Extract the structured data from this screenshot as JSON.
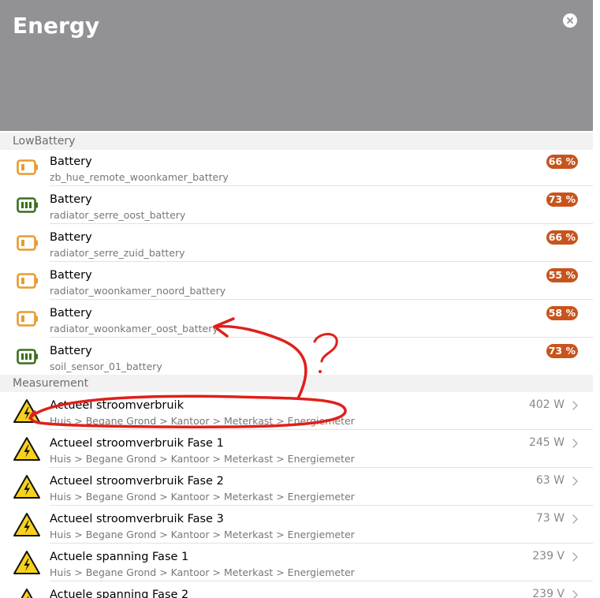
{
  "header": {
    "title": "Energy"
  },
  "sections": {
    "low_battery": "LowBattery",
    "measurement": "Measurement"
  },
  "battery_items": [
    {
      "title": "Battery",
      "subtitle": "zb_hue_remote_woonkamer_battery",
      "value": "66 %",
      "level": "low"
    },
    {
      "title": "Battery",
      "subtitle": "radiator_serre_oost_battery",
      "value": "73 %",
      "level": "high"
    },
    {
      "title": "Battery",
      "subtitle": "radiator_serre_zuid_battery",
      "value": "66 %",
      "level": "low"
    },
    {
      "title": "Battery",
      "subtitle": "radiator_woonkamer_noord_battery",
      "value": "55 %",
      "level": "low"
    },
    {
      "title": "Battery",
      "subtitle": "radiator_woonkamer_oost_battery",
      "value": "58 %",
      "level": "low"
    },
    {
      "title": "Battery",
      "subtitle": "soil_sensor_01_battery",
      "value": "73 %",
      "level": "high"
    }
  ],
  "measurement_items": [
    {
      "title": "Actueel stroomverbruik",
      "subtitle": "Huis > Begane Grond > Kantoor > Meterkast > Energiemeter",
      "value": "402 W"
    },
    {
      "title": "Actueel stroomverbruik Fase 1",
      "subtitle": "Huis > Begane Grond > Kantoor > Meterkast > Energiemeter",
      "value": "245 W"
    },
    {
      "title": "Actueel stroomverbruik Fase 2",
      "subtitle": "Huis > Begane Grond > Kantoor > Meterkast > Energiemeter",
      "value": "63 W"
    },
    {
      "title": "Actueel stroomverbruik Fase 3",
      "subtitle": "Huis > Begane Grond > Kantoor > Meterkast > Energiemeter",
      "value": "73 W"
    },
    {
      "title": "Actuele spanning Fase 1",
      "subtitle": "Huis > Begane Grond > Kantoor > Meterkast > Energiemeter",
      "value": "239 V"
    },
    {
      "title": "Actuele spanning Fase 2",
      "subtitle": "",
      "value": "239 V"
    }
  ],
  "colors": {
    "header_bg": "#929196",
    "badge_bg": "#c8541d",
    "battery_low": "#e89b2c",
    "battery_high": "#3c6e1f",
    "warning_fill": "#f7d21b",
    "annotation": "#e0201b"
  },
  "icons": {
    "battery_low": "battery-low-icon",
    "battery_high": "battery-high-icon",
    "measurement": "electric-warning-icon",
    "chevron": "chevron-right-icon",
    "close": "close-icon"
  },
  "annotation": {
    "text": "?"
  }
}
